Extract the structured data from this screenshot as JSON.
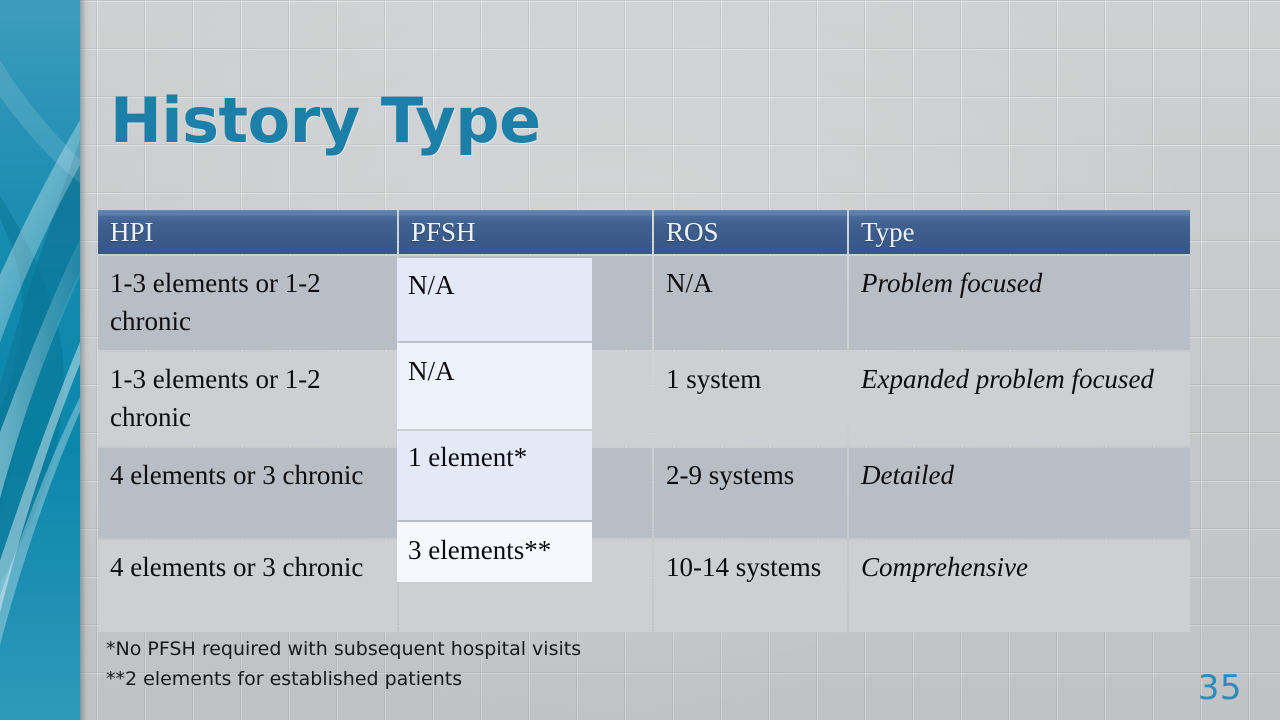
{
  "slide": {
    "title": "History Type",
    "page_number": "35",
    "accent_color": "#1b7fa8",
    "band_color": "#0c87ac",
    "header_color": "#3a5b8a",
    "highlight_color": "#e3e9f7"
  },
  "table": {
    "columns": [
      "HPI",
      "PFSH",
      "ROS",
      "Type"
    ],
    "rows": [
      {
        "hpi": "1-3 elements or 1-2 chronic",
        "pfsh": "N/A",
        "ros": "N/A",
        "type": "Problem focused"
      },
      {
        "hpi": "1-3 elements or 1-2 chronic",
        "pfsh": "N/A",
        "ros": "1 system",
        "type": "Expanded problem focused"
      },
      {
        "hpi": "4 elements or 3 chronic",
        "pfsh": "1 element*",
        "ros": "2-9 systems",
        "type": "Detailed"
      },
      {
        "hpi": "4 elements or 3 chronic",
        "pfsh": "3 elements**",
        "ros": "10-14 systems",
        "type": "Comprehensive"
      }
    ]
  },
  "footnotes": [
    "*No PFSH required with subsequent hospital visits",
    "**2 elements for established patients"
  ]
}
